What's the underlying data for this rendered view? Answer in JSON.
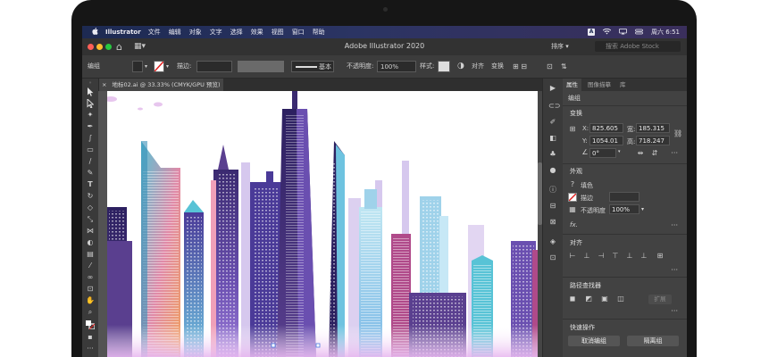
{
  "menubar": {
    "apple": "",
    "app": "Illustrator",
    "items": [
      "文件",
      "编辑",
      "对象",
      "文字",
      "选择",
      "效果",
      "视图",
      "窗口",
      "帮助"
    ],
    "input_icon": "A",
    "clock": "周六 6:51"
  },
  "titlebar": {
    "title": "Adobe Illustrator 2020",
    "sort_label": "排序",
    "stock_placeholder": "搜索 Adobe Stock"
  },
  "controlbar": {
    "selection": "编组",
    "stroke_label": "描边:",
    "stroke_style": "基本",
    "opacity_label": "不透明度:",
    "opacity_value": "100%",
    "style_label": "样式:",
    "align_label": "对齐",
    "transform_label": "变换"
  },
  "document": {
    "tab_label": "地标02.ai @ 33.33% (CMYK/GPU 预览)",
    "close": "×"
  },
  "panel": {
    "tabs": [
      "属性",
      "图像描摹",
      "库"
    ],
    "selection_type": "编组",
    "transform": {
      "title": "变换",
      "x_label": "X:",
      "x_value": "825.605",
      "y_label": "Y:",
      "y_value": "1054.01",
      "w_label": "宽:",
      "w_value": "185.315",
      "h_label": "高:",
      "h_value": "718.247",
      "angle": "0°"
    },
    "appearance": {
      "title": "外观",
      "fill_label": "填色",
      "stroke_label": "描边",
      "opacity_label": "不透明度",
      "opacity_value": "100%",
      "fx": "fx."
    },
    "align": {
      "title": "对齐"
    },
    "pathfinder": {
      "title": "路径查找器",
      "expand": "扩展"
    },
    "quick_actions": {
      "title": "快速操作",
      "ungroup": "取消编组",
      "isolate": "隔离组"
    }
  },
  "colors": {
    "ui_dark": "#323232",
    "panel": "#424242",
    "artboard": "#ffffff",
    "accent_purple": "#5a3f8f",
    "accent_teal": "#58c3d6"
  }
}
